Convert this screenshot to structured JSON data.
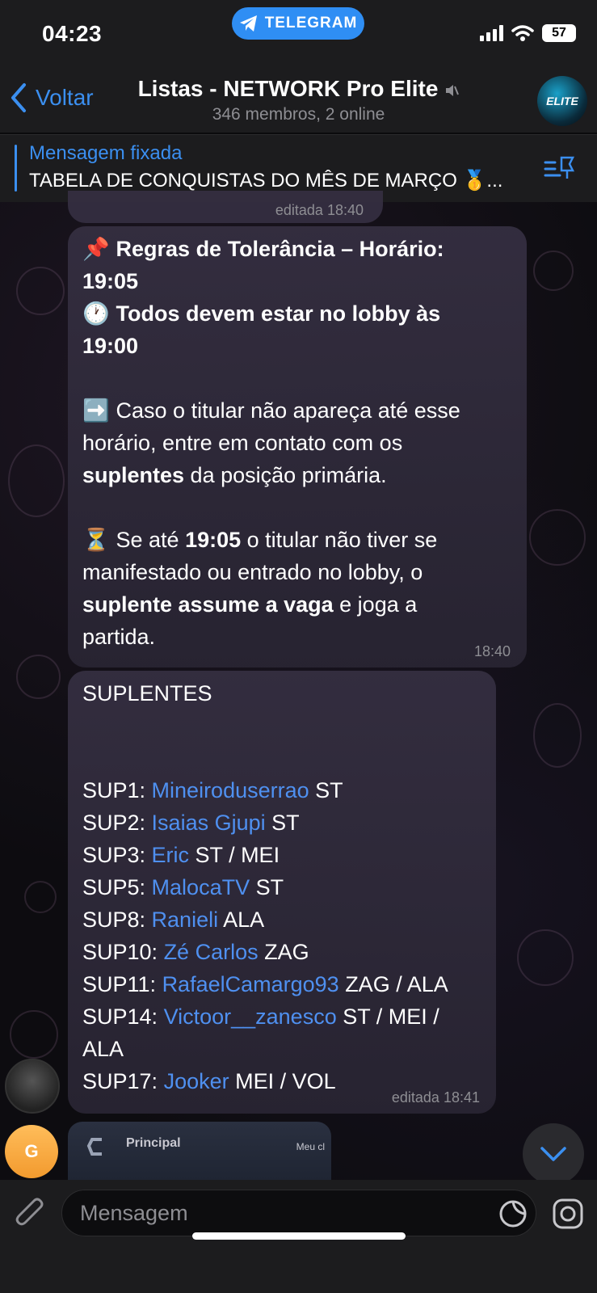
{
  "status_bar": {
    "time": "04:23",
    "app_pill": "TELEGRAM",
    "battery": "57"
  },
  "header": {
    "back_label": "Voltar",
    "title": "Listas - NETWORK Pro Elite",
    "subtitle": "346 membros, 2 online",
    "avatar_text": "ELITE"
  },
  "pinned": {
    "label": "Mensagem fixada",
    "text": "TABELA DE CONQUISTAS DO MÊS DE MARÇO 🥇..."
  },
  "prev_message": {
    "time": "editada 18:40"
  },
  "message1": {
    "line1_emoji": "📌",
    "line1": "Regras de Tolerância – Horário:",
    "line2": "19:05",
    "line3_emoji": "🕐",
    "line3": "Todos devem estar no lobby às",
    "line4": "19:00",
    "p2_emoji": "➡️",
    "p2_a": "Caso o titular não apareça até esse",
    "p2_b": "horário, entre em contato com os",
    "p2_c_bold": "suplentes",
    "p2_c_rest": " da posição primária.",
    "p3_emoji": "⏳",
    "p3_a_pre": "Se até ",
    "p3_a_bold": "19:05",
    "p3_a_post": " o titular não tiver se",
    "p3_b": "manifestado ou entrado no lobby, o",
    "p3_c_bold": "suplente assume a vaga",
    "p3_c_rest": " e joga a",
    "p3_d": "partida.",
    "time": "18:40"
  },
  "message2": {
    "heading": "SUPLENTES",
    "rows": [
      {
        "slot": "SUP1: ",
        "name": "Mineiroduserrao",
        "pos": " ST"
      },
      {
        "slot": "SUP2: ",
        "name": "Isaias Gjupi",
        "pos": " ST"
      },
      {
        "slot": "SUP3: ",
        "name": "Eric",
        "pos": " ST / MEI"
      },
      {
        "slot": "SUP5: ",
        "name": "MalocaTV",
        "pos": " ST"
      },
      {
        "slot": "SUP8: ",
        "name": "Ranieli",
        "pos": " ALA"
      },
      {
        "slot": "SUP10: ",
        "name": "Zé Carlos",
        "pos": " ZAG"
      },
      {
        "slot": "SUP11: ",
        "name": "RafaelCamargo93",
        "pos": " ZAG / ALA"
      },
      {
        "slot": "SUP14: ",
        "name": "Victoor__zanesco",
        "pos": " ST / MEI /"
      },
      {
        "slot": "",
        "name": "",
        "pos": "ALA"
      },
      {
        "slot": "SUP17: ",
        "name": "Jooker",
        "pos": " MEI / VOL"
      }
    ],
    "time": "editada 18:41"
  },
  "next_message": {
    "avatar_letter": "G",
    "label": "Principal",
    "label2": "Meu cl"
  },
  "composer": {
    "placeholder": "Mensagem"
  },
  "colors": {
    "accent": "#3b8ff0",
    "link": "#4f90f0",
    "bubble": "#342e40"
  }
}
